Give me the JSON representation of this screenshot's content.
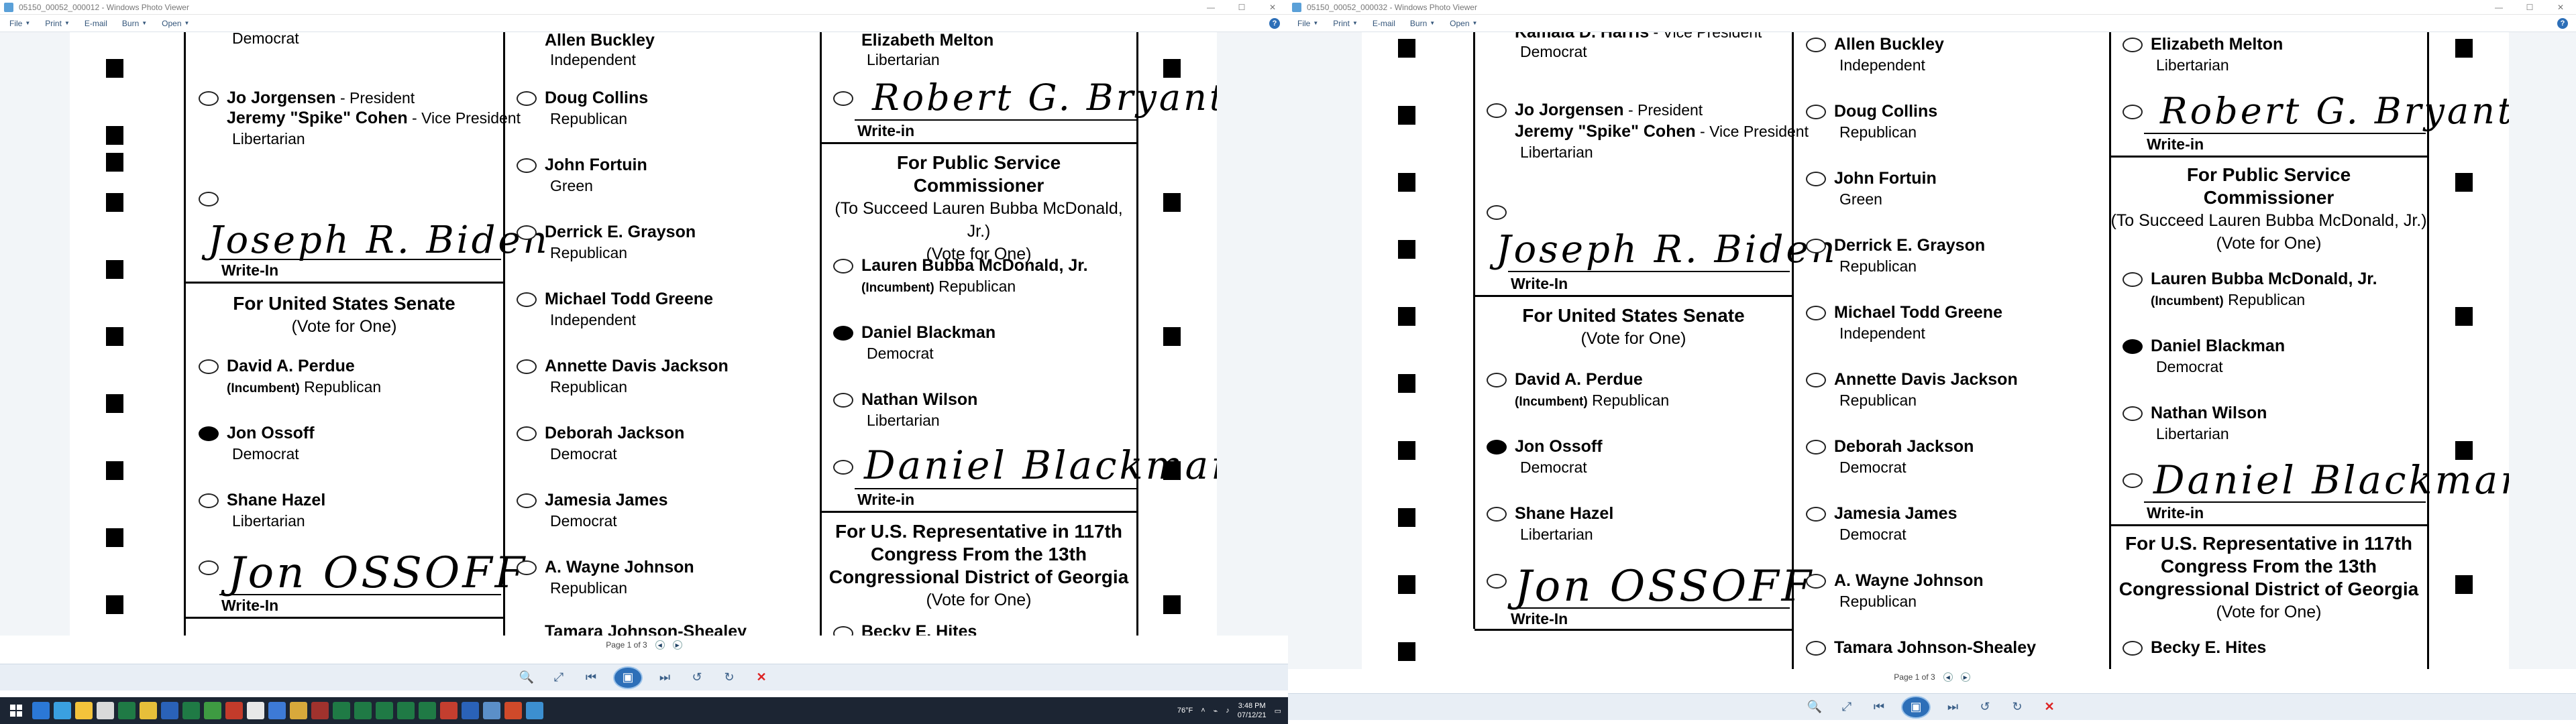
{
  "windows": [
    {
      "title": "05150_00052_000012 - Windows Photo Viewer",
      "status": "Page 1 of 3",
      "taskbar": {
        "weather": "76°F",
        "time": "3:48 PM",
        "date": "07/12/21"
      }
    },
    {
      "title": "05150_00052_000032 - Windows Photo Viewer",
      "status": "Page 1 of 3"
    }
  ],
  "menu": {
    "file": "File",
    "print": "Print",
    "email": "E-mail",
    "burn": "Burn",
    "open": "Open"
  },
  "help_glyph": "?",
  "window_controls": {
    "minimize": "—",
    "maximize": "☐",
    "close": "✕"
  },
  "ballot": {
    "col1": {
      "top_party": "Democrat",
      "jorgensen": {
        "name": "Jo Jorgensen",
        "role": " - President",
        "vp": "Jeremy \"Spike\" Cohen",
        "vp_role": " - Vice President",
        "party": "Libertarian"
      },
      "writein_president": {
        "hand": "Joseph R. Biden",
        "label": "Write-In"
      },
      "senate": {
        "title": "For United States Senate",
        "sub": "(Vote for One)"
      },
      "perdue": {
        "name": "David A. Perdue",
        "inc": "(Incumbent)",
        "party": " Republican"
      },
      "ossoff": {
        "name": "Jon Ossoff",
        "party": "Democrat"
      },
      "hazel": {
        "name": "Shane Hazel",
        "party": "Libertarian"
      },
      "writein_senate": {
        "hand": "Jon OSSOFF",
        "label": "Write-In"
      }
    },
    "col2": {
      "buckley": {
        "name": "Allen Buckley",
        "party": "Independent"
      },
      "collins": {
        "name": "Doug Collins",
        "party": "Republican"
      },
      "fortuin": {
        "name": "John Fortuin",
        "party": "Green"
      },
      "grayson": {
        "name": "Derrick E. Grayson",
        "party": "Republican"
      },
      "greene": {
        "name": "Michael Todd Greene",
        "party": "Independent"
      },
      "ajackson": {
        "name": "Annette Davis Jackson",
        "party": "Republican"
      },
      "djackson": {
        "name": "Deborah Jackson",
        "party": "Democrat"
      },
      "james": {
        "name": "Jamesia James",
        "party": "Democrat"
      },
      "johnson": {
        "name": "A. Wayne Johnson",
        "party": "Republican"
      },
      "shealey": {
        "name": "Tamara Johnson-Shealey"
      }
    },
    "col3": {
      "melton": {
        "name": "Elizabeth Melton",
        "party": "Libertarian"
      },
      "writein_top": {
        "hand": "Robert G. Bryant",
        "label": "Write-in"
      },
      "psc": {
        "title1": "For Public Service",
        "title2": "Commissioner",
        "sub1": "(To Succeed Lauren Bubba McDonald, Jr.)",
        "sub2": "(Vote for One)"
      },
      "mcdonald": {
        "name": "Lauren Bubba McDonald, Jr.",
        "inc": "(Incumbent)",
        "party": " Republican"
      },
      "blackman": {
        "name": "Daniel Blackman",
        "party": "Democrat"
      },
      "wilson": {
        "name": "Nathan Wilson",
        "party": "Libertarian"
      },
      "writein_psc": {
        "hand": "Daniel Blackman",
        "label": "Write-in"
      },
      "rep": {
        "t1": "For U.S. Representative in 117th",
        "t2": "Congress From the 13th",
        "t3": "Congressional District of Georgia",
        "sub": "(Vote for One)"
      },
      "hites": {
        "name": "Becky E. Hites"
      }
    }
  },
  "right_window_extra": {
    "harris": "Kamala D. Harris",
    "harris_role": " - Vice President"
  }
}
